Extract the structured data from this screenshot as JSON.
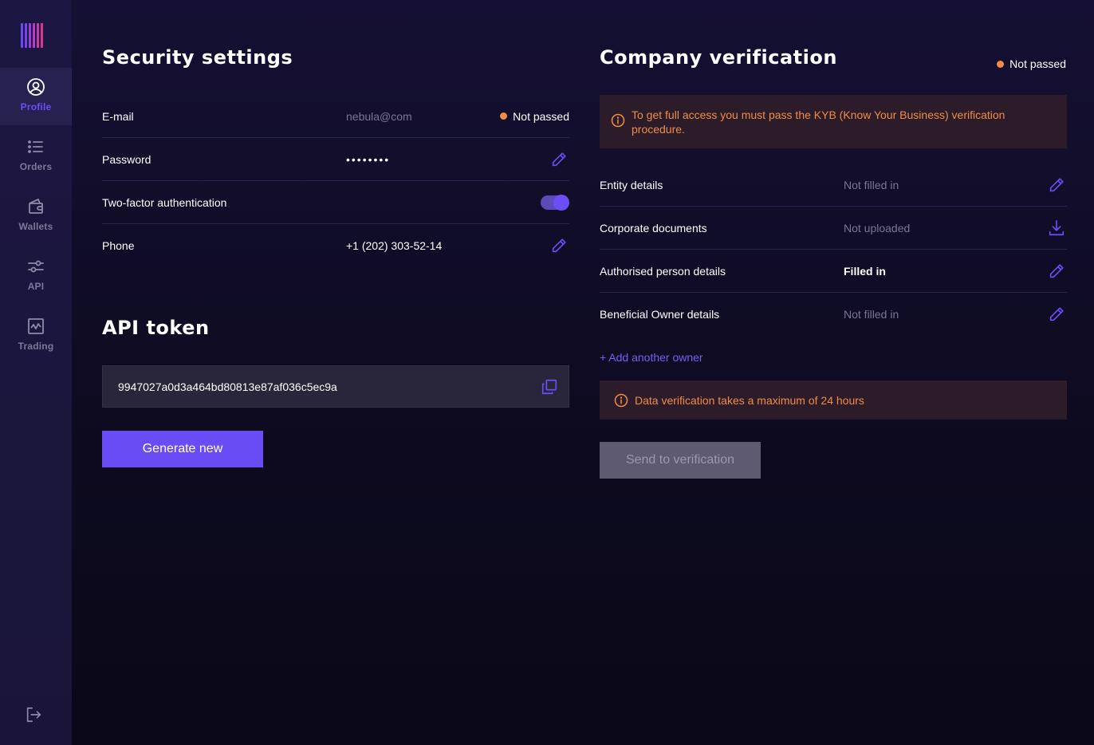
{
  "sidebar": {
    "logo_colors": [
      "#6a4cf5",
      "#7a44e8",
      "#9a3fd8",
      "#b93cc6",
      "#cc3aa8",
      "#d7388e"
    ],
    "items": [
      {
        "label": "Profile",
        "icon": "user-circle-icon",
        "active": true
      },
      {
        "label": "Orders",
        "icon": "list-icon",
        "active": false
      },
      {
        "label": "Wallets",
        "icon": "wallet-icon",
        "active": false
      },
      {
        "label": "API",
        "icon": "sliders-icon",
        "active": false
      },
      {
        "label": "Trading",
        "icon": "chart-icon",
        "active": false
      }
    ],
    "logout_icon": "logout-icon"
  },
  "security": {
    "title": "Security settings",
    "rows": [
      {
        "label": "E-mail",
        "value": "nebula@com",
        "status": "Not passed"
      },
      {
        "label": "Password",
        "value": "••••••••"
      },
      {
        "label": "Two-factor authentication",
        "toggle_on": true
      },
      {
        "label": "Phone",
        "value": "+1 (202) 303-52-14"
      }
    ]
  },
  "api": {
    "title": "API token",
    "token": "9947027a0d3a464bd80813e87af036c5ec9a",
    "generate_label": "Generate new"
  },
  "company": {
    "title": "Company verification",
    "status": "Not passed",
    "alert": "To get full access you must pass the KYB (Know Your Business) verification procedure.",
    "rows": [
      {
        "label": "Entity details",
        "value": "Not filled in",
        "action": "edit"
      },
      {
        "label": "Corporate documents",
        "value": "Not uploaded",
        "action": "download"
      },
      {
        "label": "Authorised person details",
        "value": "Filled in",
        "action": "edit"
      },
      {
        "label": "Beneficial Owner details",
        "value": "Not filled in",
        "action": "edit"
      }
    ],
    "add_owner_label": "+ Add another owner",
    "info": "Data verification takes a maximum of 24 hours",
    "send_label": "Send to verification"
  },
  "colors": {
    "accent": "#6a4cf5",
    "warning": "#f08c45",
    "background": "#110d27"
  }
}
